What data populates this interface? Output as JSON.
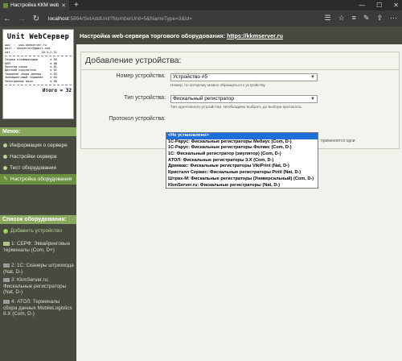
{
  "browser": {
    "tab_title": "Настройка ККМ web-сер",
    "tab_close": "✕",
    "new_tab": "+",
    "url_host": "localhost",
    "url_path": ":5894/SetAddUnit?NumberUnit=5&NameType=3&Id=",
    "win_min": "—",
    "win_max": "☐",
    "win_close": "✕",
    "back": "←",
    "forward": "→",
    "refresh": "↻"
  },
  "receipt": {
    "title": "Unit WebСервер",
    "lines": [
      "www  :  www.kkmserver.ru",
      "mail : kkmserver@gmail.com",
      "ver  :               10.3.2.51",
      "Скидка втрамычкадов       ≡ 05",
      "ККМ                       ≡ 08",
      "Принтер чеков             ≡ 01",
      "Дисплей покупателя        ≡ 01",
      "Терминал сбора данных     ≡ 02",
      "Эквайринговый терминал    ≡ 04",
      "Электронные весы          ≡ 06"
    ],
    "total": "Итого = 32"
  },
  "sidebar": {
    "menu_title": "Меню:",
    "menu": [
      {
        "label": "Информация о сервере",
        "icon": "dot"
      },
      {
        "label": "Настройки сервера",
        "icon": "dot"
      },
      {
        "label": "Тест оборудования",
        "icon": "dot"
      },
      {
        "label": "Настройка оборудования",
        "icon": "wrench"
      }
    ],
    "list_title": "Список оборудования:",
    "add_device": "Добавить устройство",
    "devices": [
      {
        "label": "1: СБРФ: Эквайринговые терминалы (Com, D+)"
      },
      {
        "label": "2: 1С: Сканеры штрихкода (Nat, D-)"
      },
      {
        "label": "3: KkmServer.ru: Фискальные регистраторы (Nat, D-)"
      },
      {
        "label": "4: АТОЛ: Терминалы сбора данных MobileLogistics 8.X (Com, D-)"
      }
    ]
  },
  "header": {
    "title": "Настройка web-сервера торгового оборудования: ",
    "link": "https://kkmserver.ru"
  },
  "form": {
    "heading": "Добавление устройства:",
    "device_number_label": "Номер устройства:",
    "device_number_value": "Устройство #5",
    "device_number_hint": "Номер, по которому можно обращаться к устройству",
    "device_type_label": "Тип устройства:",
    "device_type_value": "Фискальный регистратор",
    "device_type_hint": "Тип однотипного устройства. Необходимо выбрать до выбора протокола.",
    "protocol_label": "Протокол устройства:",
    "protocol_hint_right": "применяется одни",
    "protocol_options": [
      "<Не установлено>",
      "1С-Рарус: Фискальные регистраторы Мебиус (Com, D-)",
      "1С-Рарус: Фискальные регистраторы Феликс (Com, D-)",
      "1С: Фискальный регистратор (эмулятор) (Com, D-)",
      "АТОЛ: Фискальные регистраторы 3.X (Com, D-)",
      "Дримкас: Фискальные регистраторы VikiPrint (Nat, D-)",
      "Кристалл Сервис: Фискальные регистраторы Piritl (Nat, D-)",
      "Штрих-М: Фискальные регистраторы (Универсальный) (Com, D-)",
      "KkmServer.ru: Фискальные регистраторы (Nat, D-)"
    ],
    "protocol_selected_index": 0
  },
  "colors": {
    "sidebar_bg": "#474a3e",
    "accent": "#8aa75e",
    "selection": "#1e6fd9"
  }
}
